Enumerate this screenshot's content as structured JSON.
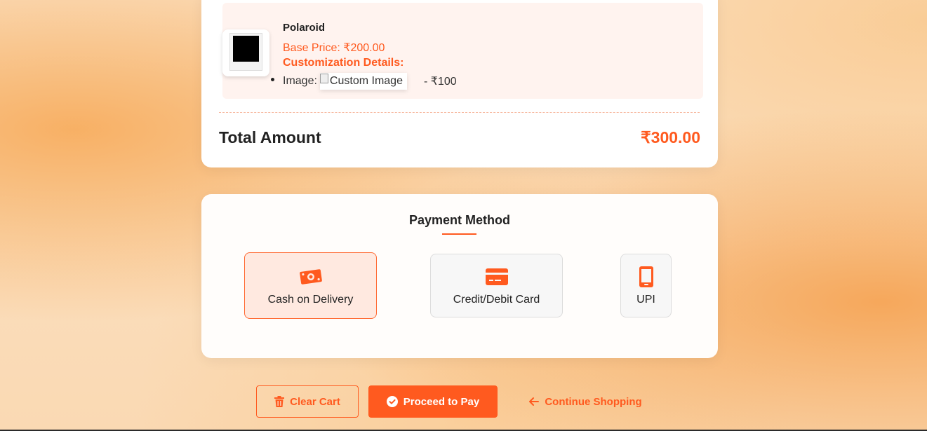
{
  "cart": {
    "item": {
      "name": "Polaroid",
      "base_price": "Base Price: ₹200.00",
      "customization_title": "Customization Details:",
      "customization_label": "Image:",
      "customization_image_alt": "Custom Image",
      "customization_price": "- ₹100"
    },
    "total_label": "Total Amount",
    "total_value": "₹300.00"
  },
  "payment": {
    "title": "Payment Method",
    "options": [
      {
        "label": "Cash on Delivery",
        "icon": "cash-icon",
        "selected": true
      },
      {
        "label": "Credit/Debit Card",
        "icon": "credit-card-icon",
        "selected": false
      },
      {
        "label": "UPI",
        "icon": "mobile-phone-icon",
        "selected": false
      }
    ]
  },
  "actions": {
    "clear_cart": "Clear Cart",
    "proceed": "Proceed to Pay",
    "continue": "Continue Shopping"
  },
  "colors": {
    "accent": "#ff5a1f",
    "selected_bg": "#ffe9e0",
    "item_bg": "#fff3ef"
  }
}
